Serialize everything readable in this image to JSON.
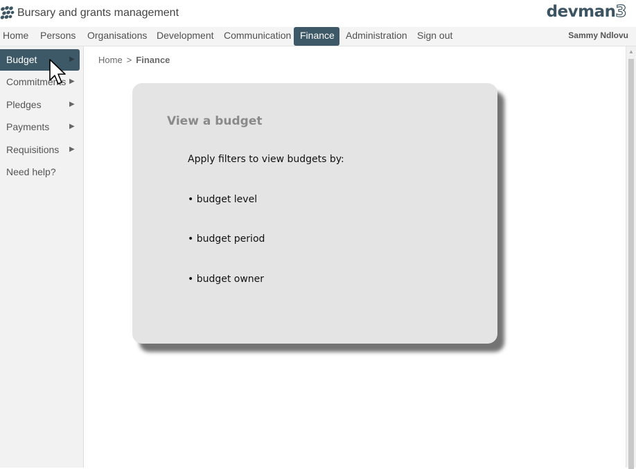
{
  "app": {
    "title": "Bursary and grants management",
    "brand_text": "devman",
    "brand_number": "3",
    "brand_color": "#3d5563",
    "accent_color": "#3d5866"
  },
  "top_nav": {
    "items": [
      {
        "label": "Home"
      },
      {
        "label": "Persons"
      },
      {
        "label": "Organisations"
      },
      {
        "label": "Development"
      },
      {
        "label": "Communication"
      },
      {
        "label": "Finance",
        "active": true
      },
      {
        "label": "Administration"
      },
      {
        "label": "Sign out"
      }
    ],
    "user_name": "Sammy Ndlovu"
  },
  "sidebar": {
    "items": [
      {
        "label": "Budget",
        "arrow": "▶",
        "active": true
      },
      {
        "label": "Commitments",
        "arrow": "▶"
      },
      {
        "label": "Pledges",
        "arrow": "▶"
      },
      {
        "label": "Payments",
        "arrow": "▶"
      },
      {
        "label": "Requisitions",
        "arrow": "▶"
      },
      {
        "label": "Need help?"
      }
    ]
  },
  "breadcrumb": {
    "home": "Home",
    "separator": ">",
    "current": "Finance"
  },
  "card": {
    "title": "View a budget",
    "intro": "Apply filters to view budgets by:",
    "bullets": [
      "• budget level",
      "• budget period",
      "• budget owner"
    ]
  },
  "icons": {
    "logo": "devman-logo-icon",
    "cursor": "mouse-pointer-icon",
    "scroll_up": "scroll-up-arrow-icon"
  }
}
